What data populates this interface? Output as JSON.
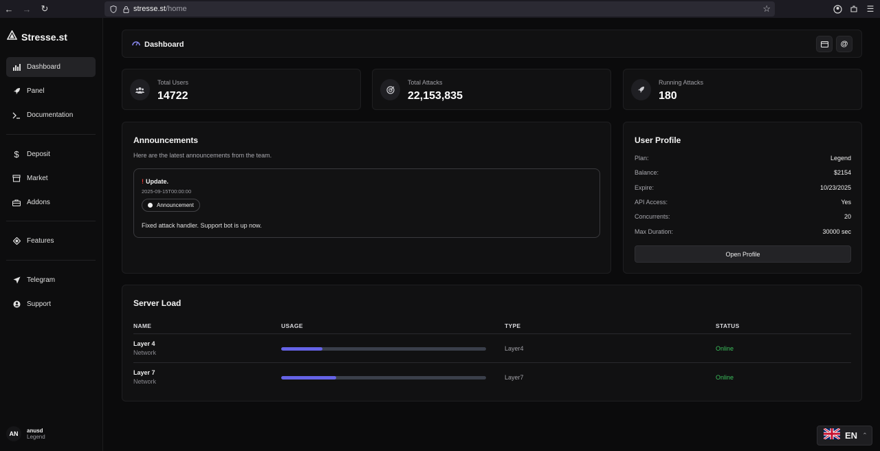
{
  "browser": {
    "url_host": "stresse.st",
    "url_path": "/home"
  },
  "sidebar": {
    "brand": "Stresse.st",
    "items": [
      {
        "label": "Dashboard",
        "icon": "bar-chart-icon"
      },
      {
        "label": "Panel",
        "icon": "rocket-icon"
      },
      {
        "label": "Documentation",
        "icon": "terminal-icon"
      },
      {
        "label": "Deposit",
        "icon": "dollar-icon"
      },
      {
        "label": "Market",
        "icon": "store-icon"
      },
      {
        "label": "Addons",
        "icon": "briefcase-icon"
      },
      {
        "label": "Features",
        "icon": "diamond-icon"
      },
      {
        "label": "Telegram",
        "icon": "send-icon"
      },
      {
        "label": "Support",
        "icon": "support-icon"
      }
    ],
    "user": {
      "initials": "AN",
      "name": "anusd",
      "plan": "Legend"
    }
  },
  "header": {
    "title": "Dashboard"
  },
  "stats": [
    {
      "label": "Total Users",
      "value": "14722"
    },
    {
      "label": "Total Attacks",
      "value": "22,153,835"
    },
    {
      "label": "Running Attacks",
      "value": "180"
    }
  ],
  "announcements": {
    "title": "Announcements",
    "subtitle": "Here are the latest announcements from the team.",
    "items": [
      {
        "mark": "!",
        "title": "Update.",
        "date": "2025-09-15T00:00:00",
        "badge": "Announcement",
        "body": "Fixed attack handler. Support bot is up now."
      }
    ]
  },
  "profile": {
    "title": "User Profile",
    "rows": [
      {
        "key": "Plan:",
        "value": "Legend"
      },
      {
        "key": "Balance:",
        "value": "$2154"
      },
      {
        "key": "Expire:",
        "value": "10/23/2025"
      },
      {
        "key": "API Access:",
        "value": "Yes"
      },
      {
        "key": "Concurrents:",
        "value": "20"
      },
      {
        "key": "Max Duration:",
        "value": "30000 sec"
      }
    ],
    "button": "Open Profile"
  },
  "server_load": {
    "title": "Server Load",
    "columns": [
      "NAME",
      "USAGE",
      "TYPE",
      "STATUS"
    ],
    "rows": [
      {
        "name": "Layer 4",
        "sub": "Network",
        "usage": 0.2,
        "type": "Layer4",
        "status": "Online"
      },
      {
        "name": "Layer 7",
        "sub": "Network",
        "usage": 0.27,
        "type": "Layer7",
        "status": "Online"
      }
    ]
  },
  "language": {
    "code": "EN"
  },
  "colors": {
    "accent": "#6563e6",
    "online": "#3bbf5c",
    "alert": "#e53935"
  }
}
